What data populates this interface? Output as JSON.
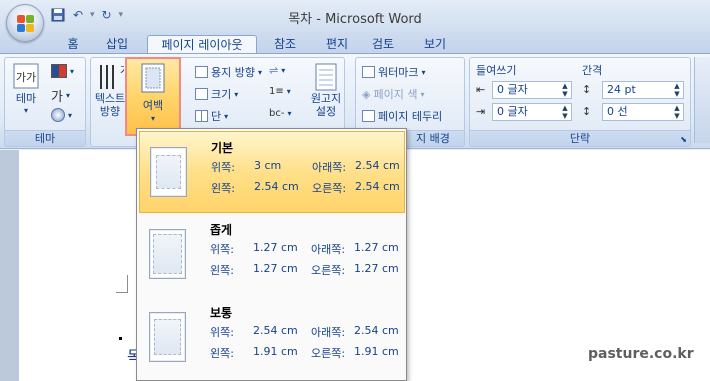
{
  "window": {
    "title": "목차 - Microsoft Word"
  },
  "qat": {
    "save_icon": "save-icon",
    "undo_icon": "undo-icon",
    "redo_icon": "redo-icon"
  },
  "tabs": [
    "홈",
    "삽입",
    "페이지 레이아웃",
    "참조",
    "편지",
    "검토",
    "보기"
  ],
  "ribbon": {
    "theme_group": {
      "label": "테마",
      "theme_button": "테마"
    },
    "page_setup": {
      "text_direction": "텍스트\n방향",
      "margins": "여백",
      "orientation": "용지 방향",
      "size": "크기",
      "columns": "단",
      "manuscript": "원고지\n설정"
    },
    "page_background": {
      "watermark": "워터마크",
      "page_color": "페이지 색",
      "page_borders": "페이지 테두리",
      "label": "지 배경"
    },
    "paragraph": {
      "label": "단락",
      "indent_title": "들여쓰기",
      "spacing_title": "간격",
      "indent_left": "0 글자",
      "indent_right": "0 글자",
      "spacing_before": "24 pt",
      "spacing_after": "0 선"
    }
  },
  "margin_menu": {
    "presets": [
      {
        "name": "기본",
        "top_label": "위쪽:",
        "top": "3 cm",
        "bottom_label": "아래쪽:",
        "bottom": "2.54 cm",
        "left_label": "왼쪽:",
        "left": "2.54 cm",
        "right_label": "오른쪽:",
        "right": "2.54 cm",
        "selected": true
      },
      {
        "name": "좁게",
        "top_label": "위쪽:",
        "top": "1.27 cm",
        "bottom_label": "아래쪽:",
        "bottom": "1.27 cm",
        "left_label": "왼쪽:",
        "left": "1.27 cm",
        "right_label": "오른쪽:",
        "right": "1.27 cm",
        "selected": false
      },
      {
        "name": "보통",
        "top_label": "위쪽:",
        "top": "2.54 cm",
        "bottom_label": "아래쪽:",
        "bottom": "2.54 cm",
        "left_label": "왼쪽:",
        "left": "1.91 cm",
        "right_label": "오른쪽:",
        "right": "1.91 cm",
        "selected": false
      }
    ]
  },
  "document": {
    "fragment": "목"
  },
  "watermark_site": "pasture.co.kr"
}
